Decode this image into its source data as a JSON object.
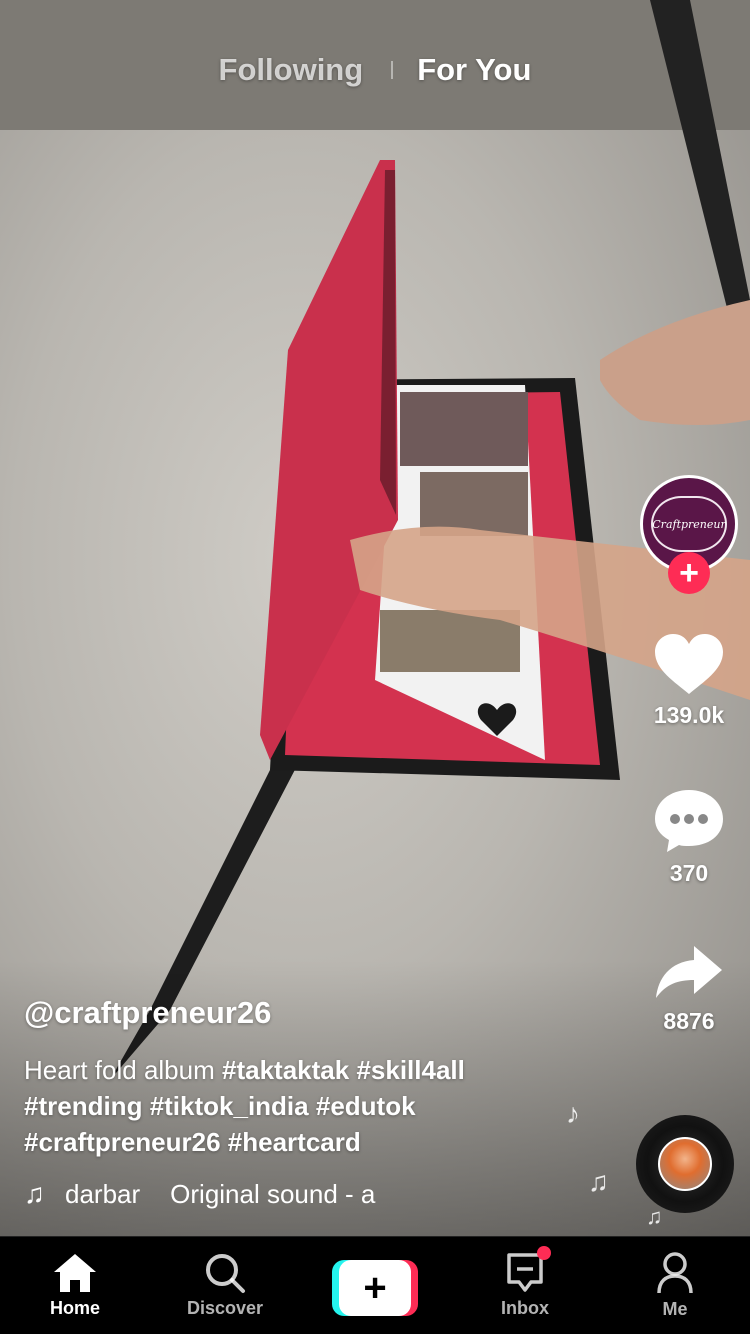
{
  "top_tabs": {
    "following": "Following",
    "for_you": "For You"
  },
  "creator": {
    "avatar_text": "Craftpreneur",
    "follow_symbol": "+"
  },
  "actions": {
    "likes": "139.0k",
    "comments": "370",
    "shares": "8876"
  },
  "caption": {
    "username": "@craftpreneur26",
    "text": "Heart fold album",
    "hashtags": [
      "#taktaktak",
      "#skill4all",
      "#trending",
      "#tiktok_india",
      "#edutok",
      "#craftpreneur26",
      "#heartcard"
    ]
  },
  "music": {
    "icon": "music-note-icon",
    "artist": "darbar",
    "title": "Original sound - a"
  },
  "bottom_nav": {
    "home": "Home",
    "discover": "Discover",
    "create_symbol": "+",
    "inbox": "Inbox",
    "me": "Me"
  },
  "colors": {
    "accent": "#fe2c55",
    "cyan": "#25f4ee",
    "nav_bg": "#000000"
  }
}
